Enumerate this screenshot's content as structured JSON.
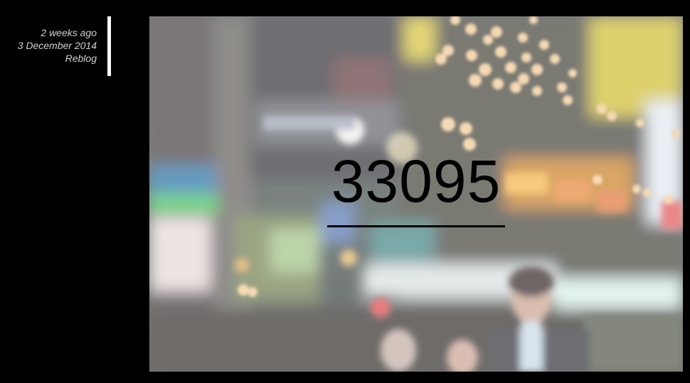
{
  "meta": {
    "relative_time": "2 weeks ago",
    "date": "3 December 2014",
    "reblog_label": "Reblog"
  },
  "post": {
    "photo_icon": "blurred-city-night-photo",
    "count": "33095"
  },
  "colors": {
    "background": "#000000",
    "meta_text": "#d0d0d0",
    "accent_bar": "#ffffff",
    "count_text": "#000000"
  }
}
